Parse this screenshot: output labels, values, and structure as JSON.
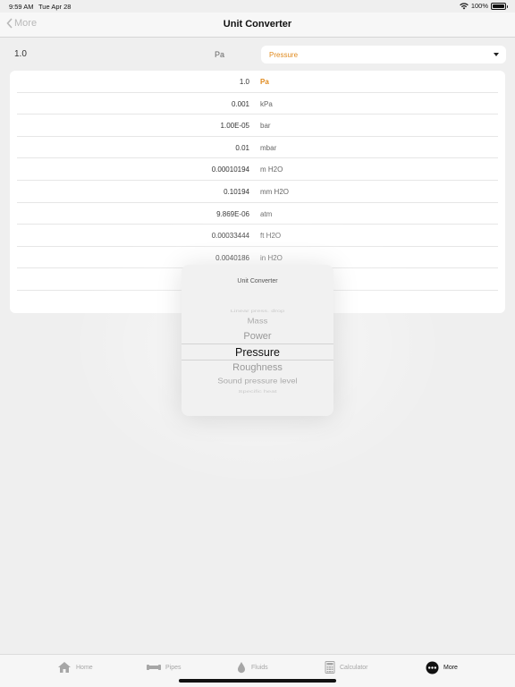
{
  "status": {
    "time": "9:59 AM",
    "date": "Tue Apr 28",
    "battery": "100%"
  },
  "nav": {
    "back_label": "More",
    "title": "Unit Converter"
  },
  "input": {
    "value": "1.0",
    "unit": "Pa",
    "category": "Pressure"
  },
  "results": [
    {
      "value": "1.0",
      "unit": "Pa",
      "active": true
    },
    {
      "value": "0.001",
      "unit": "kPa"
    },
    {
      "value": "1.00E-05",
      "unit": "bar"
    },
    {
      "value": "0.01",
      "unit": "mbar"
    },
    {
      "value": "0.00010194",
      "unit": "m H2O"
    },
    {
      "value": "0.10194",
      "unit": "mm H2O"
    },
    {
      "value": "9.869E-06",
      "unit": "atm"
    },
    {
      "value": "0.00033444",
      "unit": "ft H2O"
    },
    {
      "value": "0.0040186",
      "unit": "in H2O"
    },
    {
      "value": "",
      "unit": ""
    },
    {
      "value": "",
      "unit": ""
    }
  ],
  "picker": {
    "title": "Unit Converter",
    "options": [
      "Linear press. drop",
      "Mass",
      "Power",
      "Pressure",
      "Roughness",
      "Sound pressure level",
      "Specific heat"
    ],
    "selected": "Pressure"
  },
  "tabs": [
    {
      "label": "Home",
      "icon": "home-icon"
    },
    {
      "label": "Pipes",
      "icon": "pipe-icon"
    },
    {
      "label": "Fluids",
      "icon": "drop-icon"
    },
    {
      "label": "Calculator",
      "icon": "calculator-icon"
    },
    {
      "label": "More",
      "icon": "more-icon",
      "active": true
    }
  ],
  "colors": {
    "accent": "#e08a1e",
    "background": "#efefef"
  }
}
